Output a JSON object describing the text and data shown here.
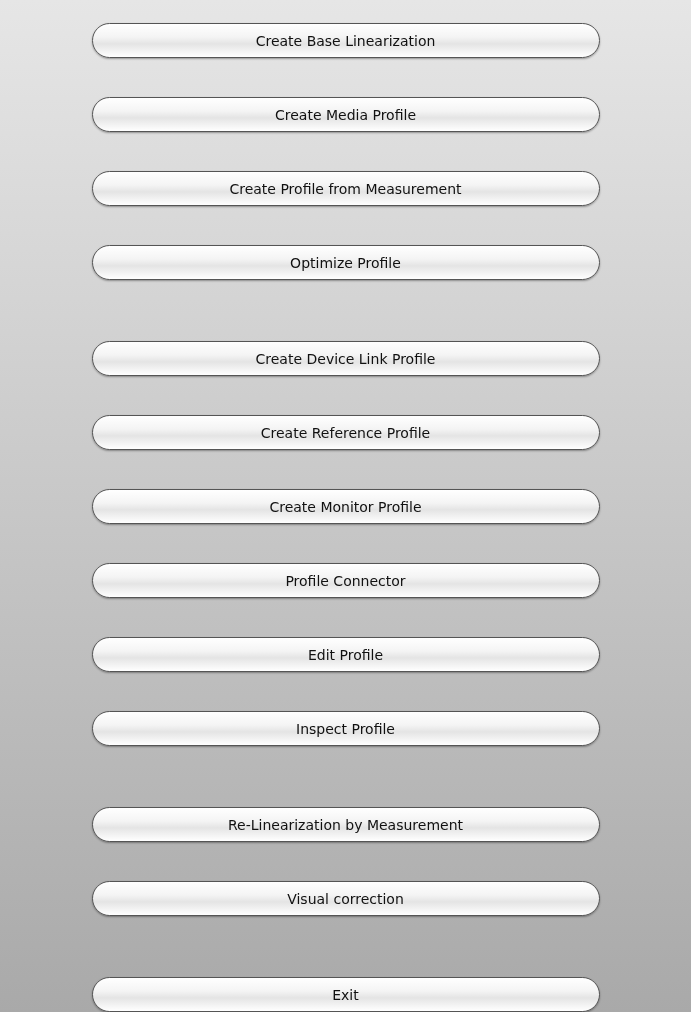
{
  "items": [
    {
      "kind": "button",
      "label": "Create Base Linearization"
    },
    {
      "kind": "button",
      "label": "Create Media Profile"
    },
    {
      "kind": "button",
      "label": "Create Profile from Measurement"
    },
    {
      "kind": "button",
      "label": "Optimize Profile"
    },
    {
      "kind": "separator"
    },
    {
      "kind": "button",
      "label": "Create Device Link Profile"
    },
    {
      "kind": "button",
      "label": "Create Reference Profile"
    },
    {
      "kind": "button",
      "label": "Create Monitor Profile"
    },
    {
      "kind": "button",
      "label": "Profile Connector"
    },
    {
      "kind": "button",
      "label": "Edit Profile"
    },
    {
      "kind": "button",
      "label": "Inspect Profile"
    },
    {
      "kind": "separator"
    },
    {
      "kind": "button",
      "label": "Re-Linearization by Measurement"
    },
    {
      "kind": "button",
      "label": "Visual correction"
    },
    {
      "kind": "separator"
    },
    {
      "kind": "button",
      "label": "Exit"
    }
  ]
}
